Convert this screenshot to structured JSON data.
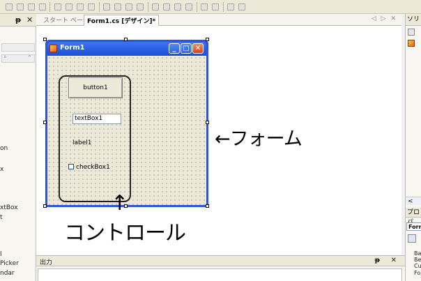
{
  "toolbox": {
    "header_controls": [
      "ᵽ",
      "✕"
    ],
    "items": [
      {
        "label": "on"
      },
      {
        "label": "x"
      },
      {
        "label": "xtBox"
      },
      {
        "label": "t"
      },
      {
        "label": "l"
      },
      {
        "label": "Picker"
      },
      {
        "label": "ndar"
      }
    ]
  },
  "tabs": {
    "start_page": "スタート ページ",
    "active": "Form1.cs [デザイン]*",
    "nav": "◁ ▷ ✕"
  },
  "form": {
    "title": "Form1",
    "caption_buttons": {
      "minimize": "_",
      "maximize": "□",
      "close": "✕"
    },
    "controls": {
      "button": "button1",
      "textbox": "textBox1",
      "label": "label1",
      "checkbox": "checkBox1"
    }
  },
  "annotations": {
    "form_callout": "←フォーム",
    "control_arrow": "↑",
    "control_callout": "コントロール"
  },
  "right_panel": {
    "solution_title": "ソリュ",
    "scroll_left": "<",
    "properties_title": "プロパ",
    "properties_object": "Form",
    "properties_rows": [
      "Ba",
      "Be",
      "Cu",
      "Fo"
    ]
  },
  "output": {
    "title": "出力",
    "controls": "ᵽ ✕"
  }
}
